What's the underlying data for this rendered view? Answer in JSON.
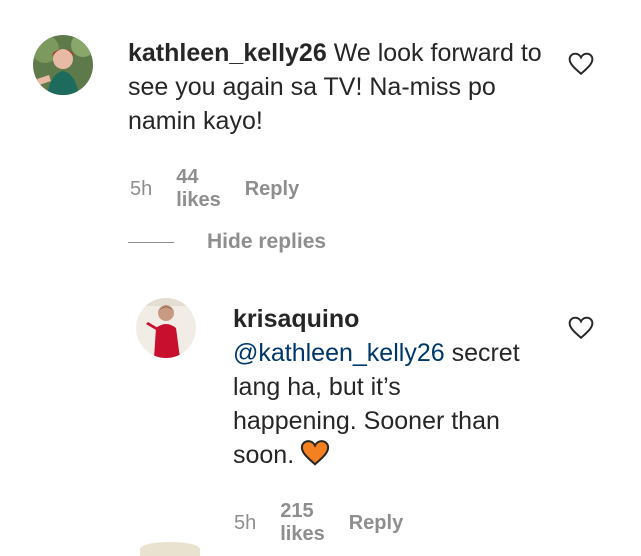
{
  "comments": [
    {
      "username": "kathleen_kelly26",
      "text": "We look forward to see you again sa TV! Na-miss po namin kayo!",
      "time": "5h",
      "likes": "44 likes",
      "reply_label": "Reply",
      "avatar_icon": "avatar-woman-green-dress"
    }
  ],
  "replies_toggle": {
    "label": "Hide replies"
  },
  "replies": [
    {
      "username": "krisaquino",
      "mention": "@kathleen_kelly26",
      "text_line1": " secret",
      "text_line2": "lang ha, but it’s",
      "text_line3": "happening. Sooner than",
      "text_line4": "soon.",
      "emoji": "orange-heart",
      "time": "5h",
      "likes": "215 likes",
      "reply_label": "Reply",
      "avatar_icon": "avatar-woman-red-dress"
    }
  ],
  "colors": {
    "text": "#262626",
    "secondary": "#8e8e8e",
    "mention": "#00376b",
    "emoji_heart": "#f4801f"
  }
}
